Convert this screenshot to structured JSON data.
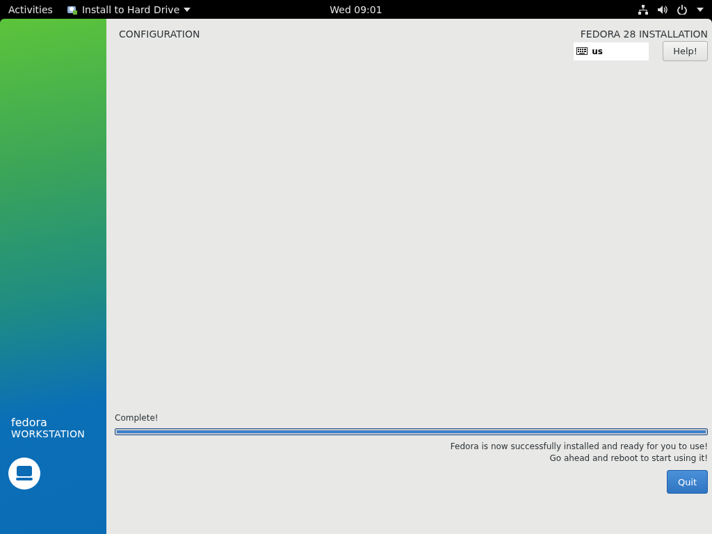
{
  "top_bar": {
    "activities": "Activities",
    "app_menu": "Install to Hard Drive",
    "clock": "Wed 09:01"
  },
  "sidebar": {
    "brand": "fedora",
    "edition": "WORKSTATION"
  },
  "header": {
    "title": "CONFIGURATION",
    "product": "FEDORA 28 INSTALLATION",
    "keyboard_layout": "us",
    "help_button": "Help!"
  },
  "progress": {
    "label": "Complete!",
    "level": 1
  },
  "message_lines": [
    "Fedora is now successfully installed and ready for you to use!",
    "Go ahead and reboot to start using it!"
  ],
  "quit_button": "Quit"
}
